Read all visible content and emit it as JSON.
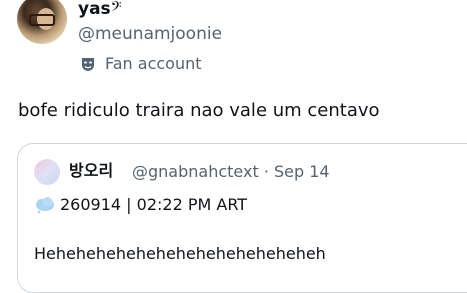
{
  "author": {
    "display_name": "yas",
    "name_symbol": "𝄢",
    "handle": "@meunamjoonie",
    "label": "Fan account"
  },
  "tweet": {
    "text": "bofe ridiculo traira nao vale um centavo"
  },
  "quoted": {
    "display_name": "방오리",
    "handle": "@gnabnahctext",
    "separator": "·",
    "date": "Sep 14",
    "line1": "260914 | 02:22 PM ART",
    "body": "Heheheheheheheheheheheheheheh"
  },
  "icons": {
    "fan_label": "theater-mask-icon",
    "weather": "cloud-icon"
  }
}
